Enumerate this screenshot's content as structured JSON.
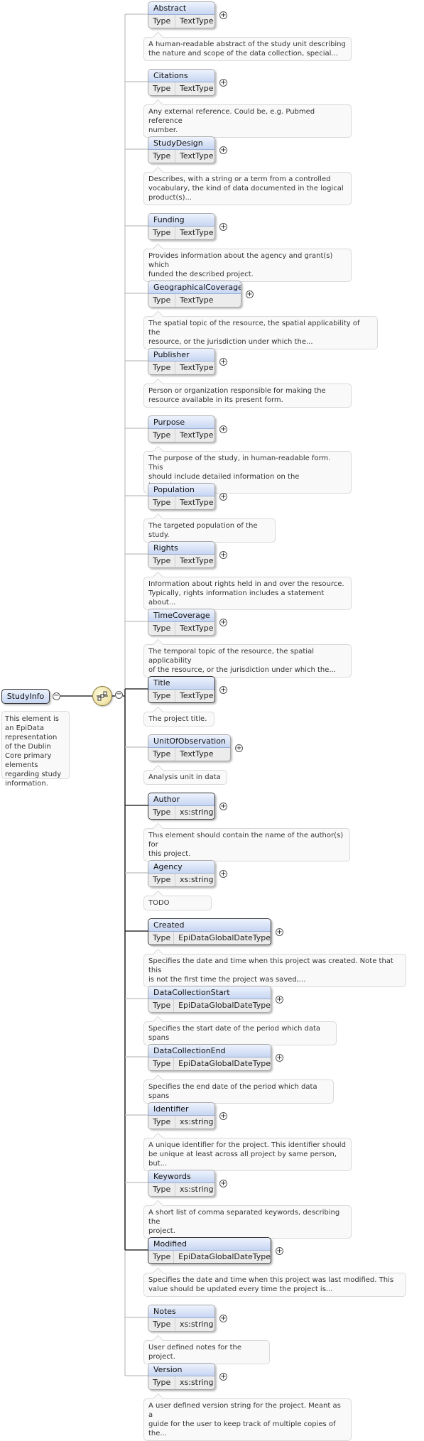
{
  "root": {
    "name": "StudyInfo",
    "doc": "This element is an EpiData representation of the Dublin Core primary elements regarding study information."
  },
  "type_label": "Type",
  "expand_symbol": "+",
  "collapse_symbol": "−",
  "elements": [
    {
      "name": "Abstract",
      "type": "TextType",
      "mandatory": false,
      "doc": "A human-readable abstract of the study unit describing\nthe nature and scope of the data collection, special..."
    },
    {
      "name": "Citations",
      "type": "TextType",
      "mandatory": false,
      "doc": "Any external reference. Could be, e.g. Pubmed reference\nnumber."
    },
    {
      "name": "StudyDesign",
      "type": "TextType",
      "mandatory": false,
      "doc": "Describes, with a string or a term from a controlled\nvocabulary, the kind of data documented in the logical\nproduct(s)..."
    },
    {
      "name": "Funding",
      "type": "TextType",
      "mandatory": false,
      "doc": "Provides information about the agency and grant(s) which\nfunded the described project."
    },
    {
      "name": "GeographicalCoverage",
      "type": "TextType",
      "mandatory": false,
      "doc": "The spatial topic of the resource, the spatial applicability of the\nresource, or the jurisdiction under which the..."
    },
    {
      "name": "Publisher",
      "type": "TextType",
      "mandatory": false,
      "doc": "Person or organization responsible for making the\nresource available in its present form."
    },
    {
      "name": "Purpose",
      "type": "TextType",
      "mandatory": false,
      "doc": "The purpose of the study, in human-readable form. This\nshould include detailed information on the investigator's..."
    },
    {
      "name": "Population",
      "type": "TextType",
      "mandatory": false,
      "doc": "The targeted population of the study."
    },
    {
      "name": "Rights",
      "type": "TextType",
      "mandatory": false,
      "doc": "Information about rights held in and over the resource.\nTypically, rights information includes a statement about..."
    },
    {
      "name": "TimeCoverage",
      "type": "TextType",
      "mandatory": false,
      "doc": "The temporal topic of the resource, the spatial applicability\nof the resource, or the jurisdiction under which the..."
    },
    {
      "name": "Title",
      "type": "TextType",
      "mandatory": true,
      "doc": "The project title."
    },
    {
      "name": "UnitOfObservation",
      "type": "TextType",
      "mandatory": false,
      "doc": "Analysis unit in data"
    },
    {
      "name": "Author",
      "type": "xs:string",
      "mandatory": true,
      "doc": "This element should contain the name of the author(s) for\nthis project."
    },
    {
      "name": "Agency",
      "type": "xs:string",
      "mandatory": false,
      "doc": "TODO"
    },
    {
      "name": "Created",
      "type": "EpiDataGlobalDateType",
      "mandatory": true,
      "doc": "Specifies the date and time when this project was created. Note that this\nis not the first time the project was saved,..."
    },
    {
      "name": "DataCollectionStart",
      "type": "EpiDataGlobalDateType",
      "mandatory": false,
      "doc": "Specifies the start date of the period which data spans"
    },
    {
      "name": "DataCollectionEnd",
      "type": "EpiDataGlobalDateType",
      "mandatory": false,
      "doc": "Specifies the end date of the period which data spans"
    },
    {
      "name": "Identifier",
      "type": "xs:string",
      "mandatory": false,
      "doc": "A unique identifier for the project. This identifier should\nbe unique at least across all project by same person, but..."
    },
    {
      "name": "Keywords",
      "type": "xs:string",
      "mandatory": false,
      "doc": "A short list of comma separated keywords, describing the\nproject."
    },
    {
      "name": "Modified",
      "type": "EpiDataGlobalDateType",
      "mandatory": true,
      "doc": "Specifies the date and time when this project was last modified. This\nvalue should be updated every time the project is..."
    },
    {
      "name": "Notes",
      "type": "xs:string",
      "mandatory": false,
      "doc": "User defined notes for the project."
    },
    {
      "name": "Version",
      "type": "xs:string",
      "mandatory": false,
      "doc": "A user defined version string for the project. Meant as a\nguide for the user to keep track of multiple copies of the..."
    }
  ]
}
